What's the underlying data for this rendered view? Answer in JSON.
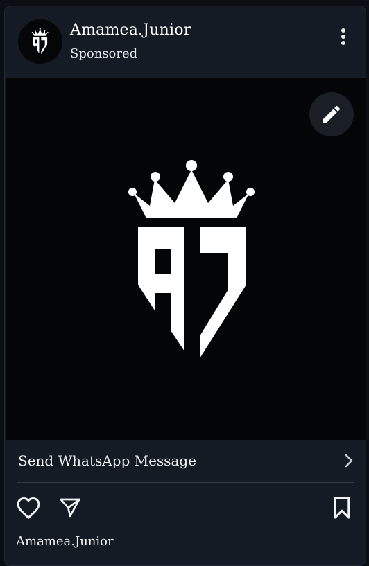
{
  "post": {
    "account_name": "Amamea.Junior",
    "sponsored_label": "Sponsored",
    "cta_label": "Send WhatsApp Message",
    "caption_username": "Amamea.Junior"
  },
  "logo": {
    "letters": "AJ"
  },
  "icons": {
    "avatar": "aj-crown-logo",
    "more": "vertical-dots-icon",
    "edit": "pencil-icon",
    "cta_chevron": "chevron-right-icon",
    "like": "heart-icon",
    "share": "paper-plane-icon",
    "save": "bookmark-icon"
  },
  "colors": {
    "card_background": "#151b24",
    "media_background": "#040506",
    "text": "#f2f3f5",
    "divider": "#323a46"
  }
}
